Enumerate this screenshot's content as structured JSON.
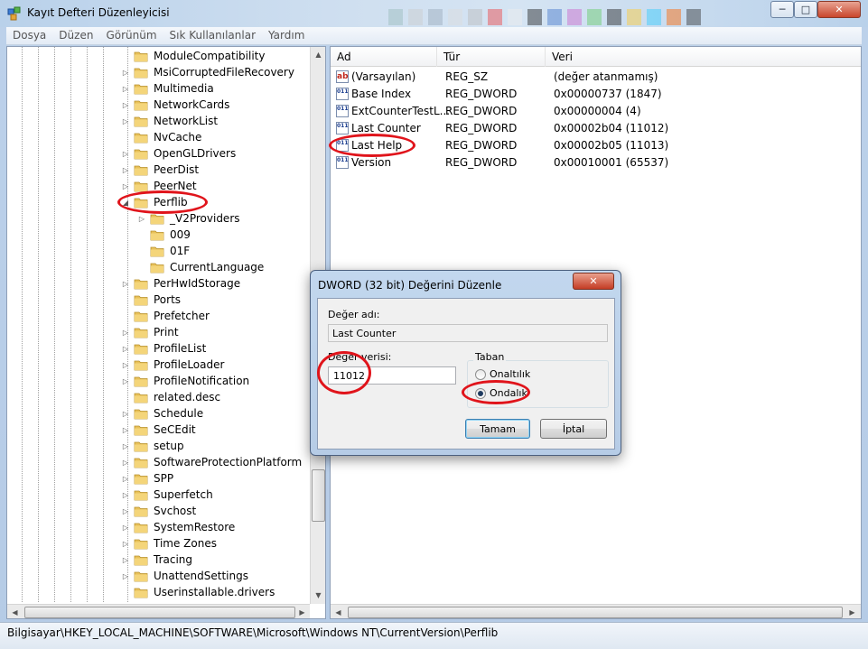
{
  "window": {
    "title": "Kayıt Defteri Düzenleyicisi",
    "icon": "regedit-icon",
    "controls": [
      "─",
      "□",
      "✕"
    ]
  },
  "menu": [
    "Dosya",
    "Düzen",
    "Görünüm",
    "Sık Kullanılanlar",
    "Yardım"
  ],
  "tree": {
    "items": [
      {
        "label": "ModuleCompatibility",
        "expander": ""
      },
      {
        "label": "MsiCorruptedFileRecovery",
        "expander": "▷"
      },
      {
        "label": "Multimedia",
        "expander": "▷"
      },
      {
        "label": "NetworkCards",
        "expander": "▷"
      },
      {
        "label": "NetworkList",
        "expander": "▷"
      },
      {
        "label": "NvCache",
        "expander": ""
      },
      {
        "label": "OpenGLDrivers",
        "expander": "▷"
      },
      {
        "label": "PeerDist",
        "expander": "▷"
      },
      {
        "label": "PeerNet",
        "expander": "▷"
      },
      {
        "label": "Perflib",
        "expander": "◢"
      },
      {
        "label": "_V2Providers",
        "expander": "▷",
        "child": true
      },
      {
        "label": "009",
        "expander": "",
        "child": true
      },
      {
        "label": "01F",
        "expander": "",
        "child": true
      },
      {
        "label": "CurrentLanguage",
        "expander": "",
        "child": true
      },
      {
        "label": "PerHwIdStorage",
        "expander": "▷"
      },
      {
        "label": "Ports",
        "expander": ""
      },
      {
        "label": "Prefetcher",
        "expander": ""
      },
      {
        "label": "Print",
        "expander": "▷"
      },
      {
        "label": "ProfileList",
        "expander": "▷"
      },
      {
        "label": "ProfileLoader",
        "expander": "▷"
      },
      {
        "label": "ProfileNotification",
        "expander": "▷"
      },
      {
        "label": "related.desc",
        "expander": ""
      },
      {
        "label": "Schedule",
        "expander": "▷"
      },
      {
        "label": "SeCEdit",
        "expander": "▷"
      },
      {
        "label": "setup",
        "expander": "▷"
      },
      {
        "label": "SoftwareProtectionPlatform",
        "expander": "▷"
      },
      {
        "label": "SPP",
        "expander": "▷"
      },
      {
        "label": "Superfetch",
        "expander": "▷"
      },
      {
        "label": "Svchost",
        "expander": "▷"
      },
      {
        "label": "SystemRestore",
        "expander": "▷"
      },
      {
        "label": "Time Zones",
        "expander": "▷"
      },
      {
        "label": "Tracing",
        "expander": "▷"
      },
      {
        "label": "UnattendSettings",
        "expander": "▷"
      },
      {
        "label": "Userinstallable.drivers",
        "expander": ""
      }
    ]
  },
  "list": {
    "headers": [
      "Ad",
      "Tür",
      "Veri"
    ],
    "rows": [
      {
        "icon": "ab",
        "name": "(Varsayılan)",
        "type": "REG_SZ",
        "data": "(değer atanmamış)"
      },
      {
        "icon": "011",
        "name": "Base Index",
        "type": "REG_DWORD",
        "data": "0x00000737 (1847)"
      },
      {
        "icon": "011",
        "name": "ExtCounterTestL...",
        "type": "REG_DWORD",
        "data": "0x00000004 (4)"
      },
      {
        "icon": "011",
        "name": "Last Counter",
        "type": "REG_DWORD",
        "data": "0x00002b04 (11012)"
      },
      {
        "icon": "011",
        "name": "Last Help",
        "type": "REG_DWORD",
        "data": "0x00002b05 (11013)"
      },
      {
        "icon": "011",
        "name": "Version",
        "type": "REG_DWORD",
        "data": "0x00010001 (65537)"
      }
    ]
  },
  "status": {
    "path": "Bilgisayar\\HKEY_LOCAL_MACHINE\\SOFTWARE\\Microsoft\\Windows NT\\CurrentVersion\\Perflib"
  },
  "dialog": {
    "title": "DWORD (32 bit) Değerini Düzenle",
    "close": "✕",
    "name_label": "Değer adı:",
    "name_value": "Last Counter",
    "data_label": "Değer verisi:",
    "data_value": "11012",
    "base_label": "Taban",
    "base_options": [
      {
        "label": "Onaltılık",
        "checked": false
      },
      {
        "label": "Ondalık",
        "checked": true
      }
    ],
    "ok_label": "Tamam",
    "cancel_label": "İptal"
  },
  "colors": {
    "annotation": "#e0141b",
    "folder": "#e8c15a"
  }
}
